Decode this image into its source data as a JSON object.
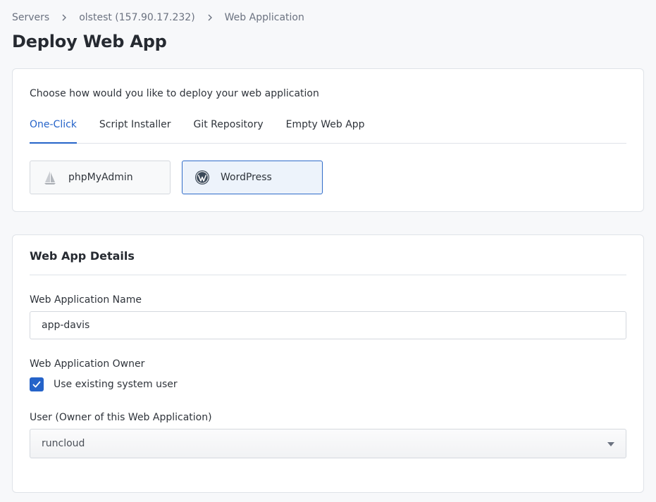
{
  "breadcrumb": {
    "items": [
      "Servers",
      "olstest (157.90.17.232)",
      "Web Application"
    ]
  },
  "page": {
    "title": "Deploy Web App"
  },
  "deploy": {
    "intro": "Choose how would you like to deploy your web application",
    "tabs": [
      {
        "label": "One-Click",
        "active": true
      },
      {
        "label": "Script Installer",
        "active": false
      },
      {
        "label": "Git Repository",
        "active": false
      },
      {
        "label": "Empty Web App",
        "active": false
      }
    ],
    "apps": [
      {
        "label": "phpMyAdmin",
        "icon": "phpmyadmin-sail-icon",
        "selected": false
      },
      {
        "label": "WordPress",
        "icon": "wordpress-logo-icon",
        "selected": true
      }
    ]
  },
  "details": {
    "title": "Web App Details",
    "name_label": "Web Application Name",
    "name_value": "app-davis",
    "owner_label": "Web Application Owner",
    "existing_user_label": "Use existing system user",
    "existing_user_checked": true,
    "user_label": "User (Owner of this Web Application)",
    "user_value": "runcloud"
  },
  "colors": {
    "accent": "#2563c9",
    "selected_tile_bg": "#edf3fb",
    "border": "#dfe3e8",
    "page_bg": "#f7f8fa"
  }
}
